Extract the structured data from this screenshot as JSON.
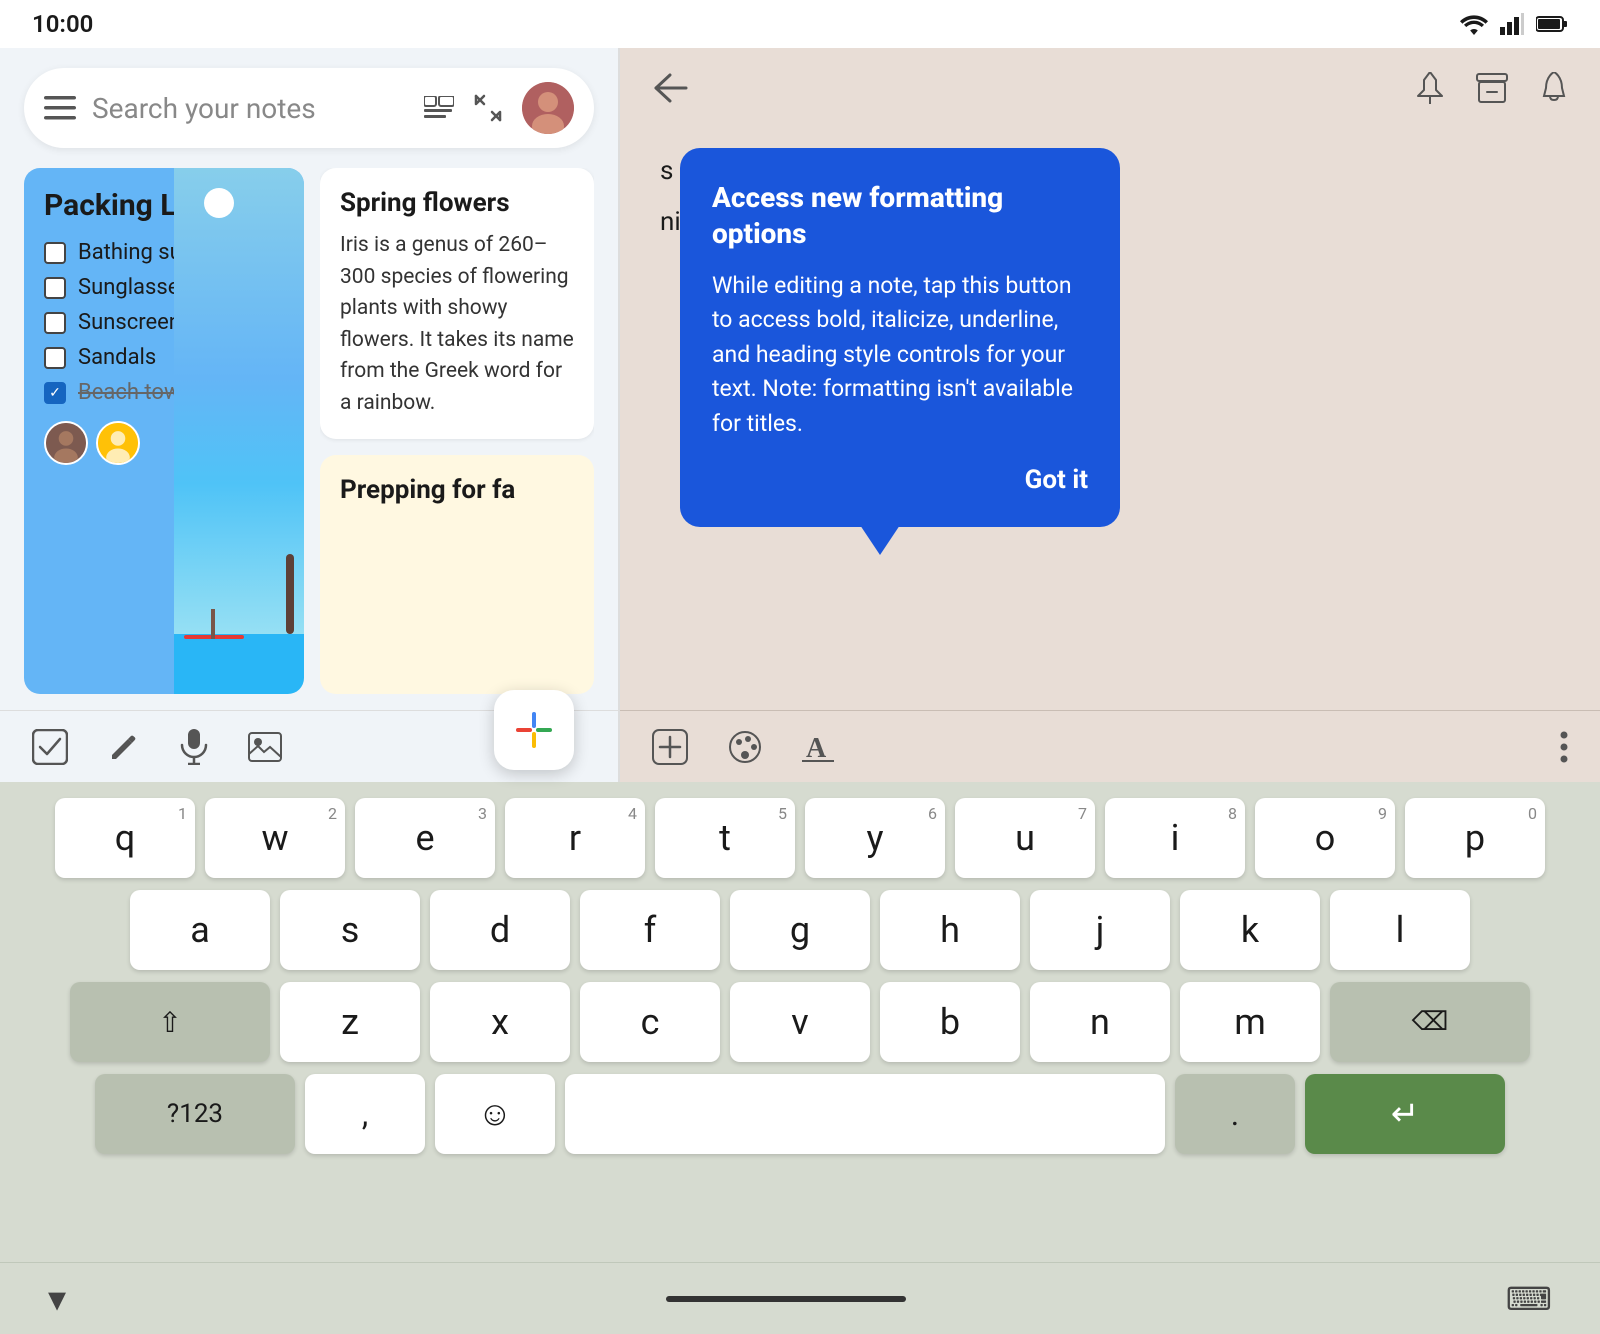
{
  "statusBar": {
    "time": "10:00",
    "icons": [
      "wifi",
      "signal",
      "battery"
    ]
  },
  "leftPanel": {
    "searchBar": {
      "placeholder": "Search your notes",
      "icons": [
        "menu",
        "grid-view",
        "expand",
        "avatar"
      ]
    },
    "packingCard": {
      "title": "Packing List",
      "items": [
        {
          "label": "Bathing suit",
          "checked": false
        },
        {
          "label": "Sunglasses",
          "checked": false
        },
        {
          "label": "Sunscreen",
          "checked": false
        },
        {
          "label": "Sandals",
          "checked": false
        },
        {
          "label": "Beach towel",
          "checked": true,
          "strikethrough": true
        }
      ]
    },
    "springCard": {
      "title": "Spring flowers",
      "text": "Iris is a genus of 260–300 species of flowering plants with showy flowers. It takes its name from the Greek word for a rainbow."
    },
    "preppingCard": {
      "title": "Prepping for fa"
    },
    "fab": {
      "label": "+"
    },
    "toolbar": {
      "icons": [
        "checkbox",
        "pencil",
        "mic",
        "image"
      ]
    }
  },
  "rightPanel": {
    "topBar": {
      "icons": [
        "back",
        "pin",
        "archive",
        "bell"
      ]
    },
    "noteLines": [
      "s spp.)",
      "nium x oxonianum)"
    ],
    "tooltip": {
      "title": "Access new formatting options",
      "body": "While editing a note, tap this button to access bold, italicize, underline, and heading style controls for your text. Note: formatting isn't available for titles.",
      "gotIt": "Got it"
    },
    "toolbar": {
      "icons": [
        "add",
        "palette",
        "format-text",
        "more"
      ]
    }
  },
  "keyboard": {
    "rows": [
      [
        {
          "key": "q",
          "num": "1"
        },
        {
          "key": "w",
          "num": "2"
        },
        {
          "key": "e",
          "num": "3"
        },
        {
          "key": "r",
          "num": "4"
        },
        {
          "key": "t",
          "num": "5"
        },
        {
          "key": "y",
          "num": "6"
        },
        {
          "key": "u",
          "num": "7"
        },
        {
          "key": "i",
          "num": "8"
        },
        {
          "key": "o",
          "num": "9"
        },
        {
          "key": "p",
          "num": "0"
        }
      ],
      [
        {
          "key": "a"
        },
        {
          "key": "s"
        },
        {
          "key": "d"
        },
        {
          "key": "f"
        },
        {
          "key": "g"
        },
        {
          "key": "h"
        },
        {
          "key": "j"
        },
        {
          "key": "k"
        },
        {
          "key": "l"
        }
      ],
      [
        {
          "key": "⇧",
          "wide": true,
          "shift": true
        },
        {
          "key": "z"
        },
        {
          "key": "x"
        },
        {
          "key": "c"
        },
        {
          "key": "v"
        },
        {
          "key": "b"
        },
        {
          "key": "n"
        },
        {
          "key": "m"
        },
        {
          "key": "⌫",
          "wide": true,
          "backspace": true
        }
      ],
      [
        {
          "key": "?123",
          "wide": true,
          "num": true
        },
        {
          "key": ","
        },
        {
          "key": "☺",
          "emoji": true
        },
        {
          "key": " ",
          "space": true
        },
        {
          "key": ".",
          "dot": true
        },
        {
          "key": "↵",
          "enter": true
        }
      ]
    ],
    "navBar": {
      "hideLabel": "▾",
      "keyboardLabel": "⌨"
    }
  }
}
